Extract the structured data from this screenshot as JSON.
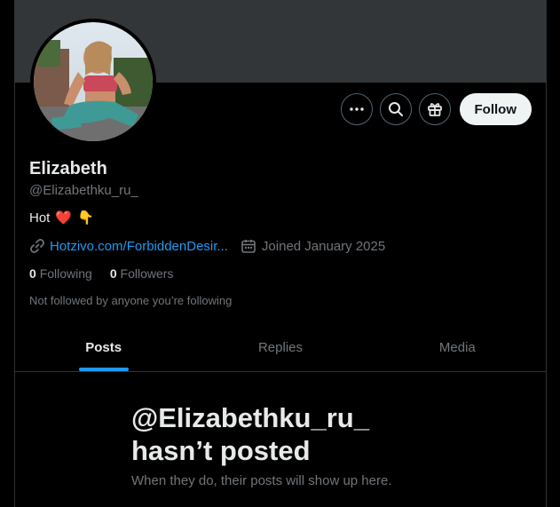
{
  "profile": {
    "name": "Elizabeth",
    "handle": "@Elizabethku_ru_",
    "bio_text": "Hot",
    "bio_emoji_heart": "❤️",
    "bio_emoji_point": "👇",
    "link": "Hotzivo.com/ForbiddenDesir...",
    "joined": "Joined January 2025",
    "following_count": "0",
    "following_label": "Following",
    "followers_count": "0",
    "followers_label": "Followers",
    "followed_by": "Not followed by anyone you’re following"
  },
  "actions": {
    "more_icon": "more-icon",
    "search_icon": "search-icon",
    "subscribe_icon": "gift-icon",
    "follow_label": "Follow"
  },
  "tabs": [
    {
      "label": "Posts",
      "active": true
    },
    {
      "label": "Replies",
      "active": false
    },
    {
      "label": "Media",
      "active": false
    }
  ],
  "empty_state": {
    "title_line1": "@Elizabethku_ru_",
    "title_line2": "hasn’t posted",
    "subtitle": "When they do, their posts will show up here."
  },
  "colors": {
    "background": "#000000",
    "banner": "#333639",
    "accent": "#1d9bf0",
    "muted": "#71767b",
    "text": "#e7e9ea"
  }
}
